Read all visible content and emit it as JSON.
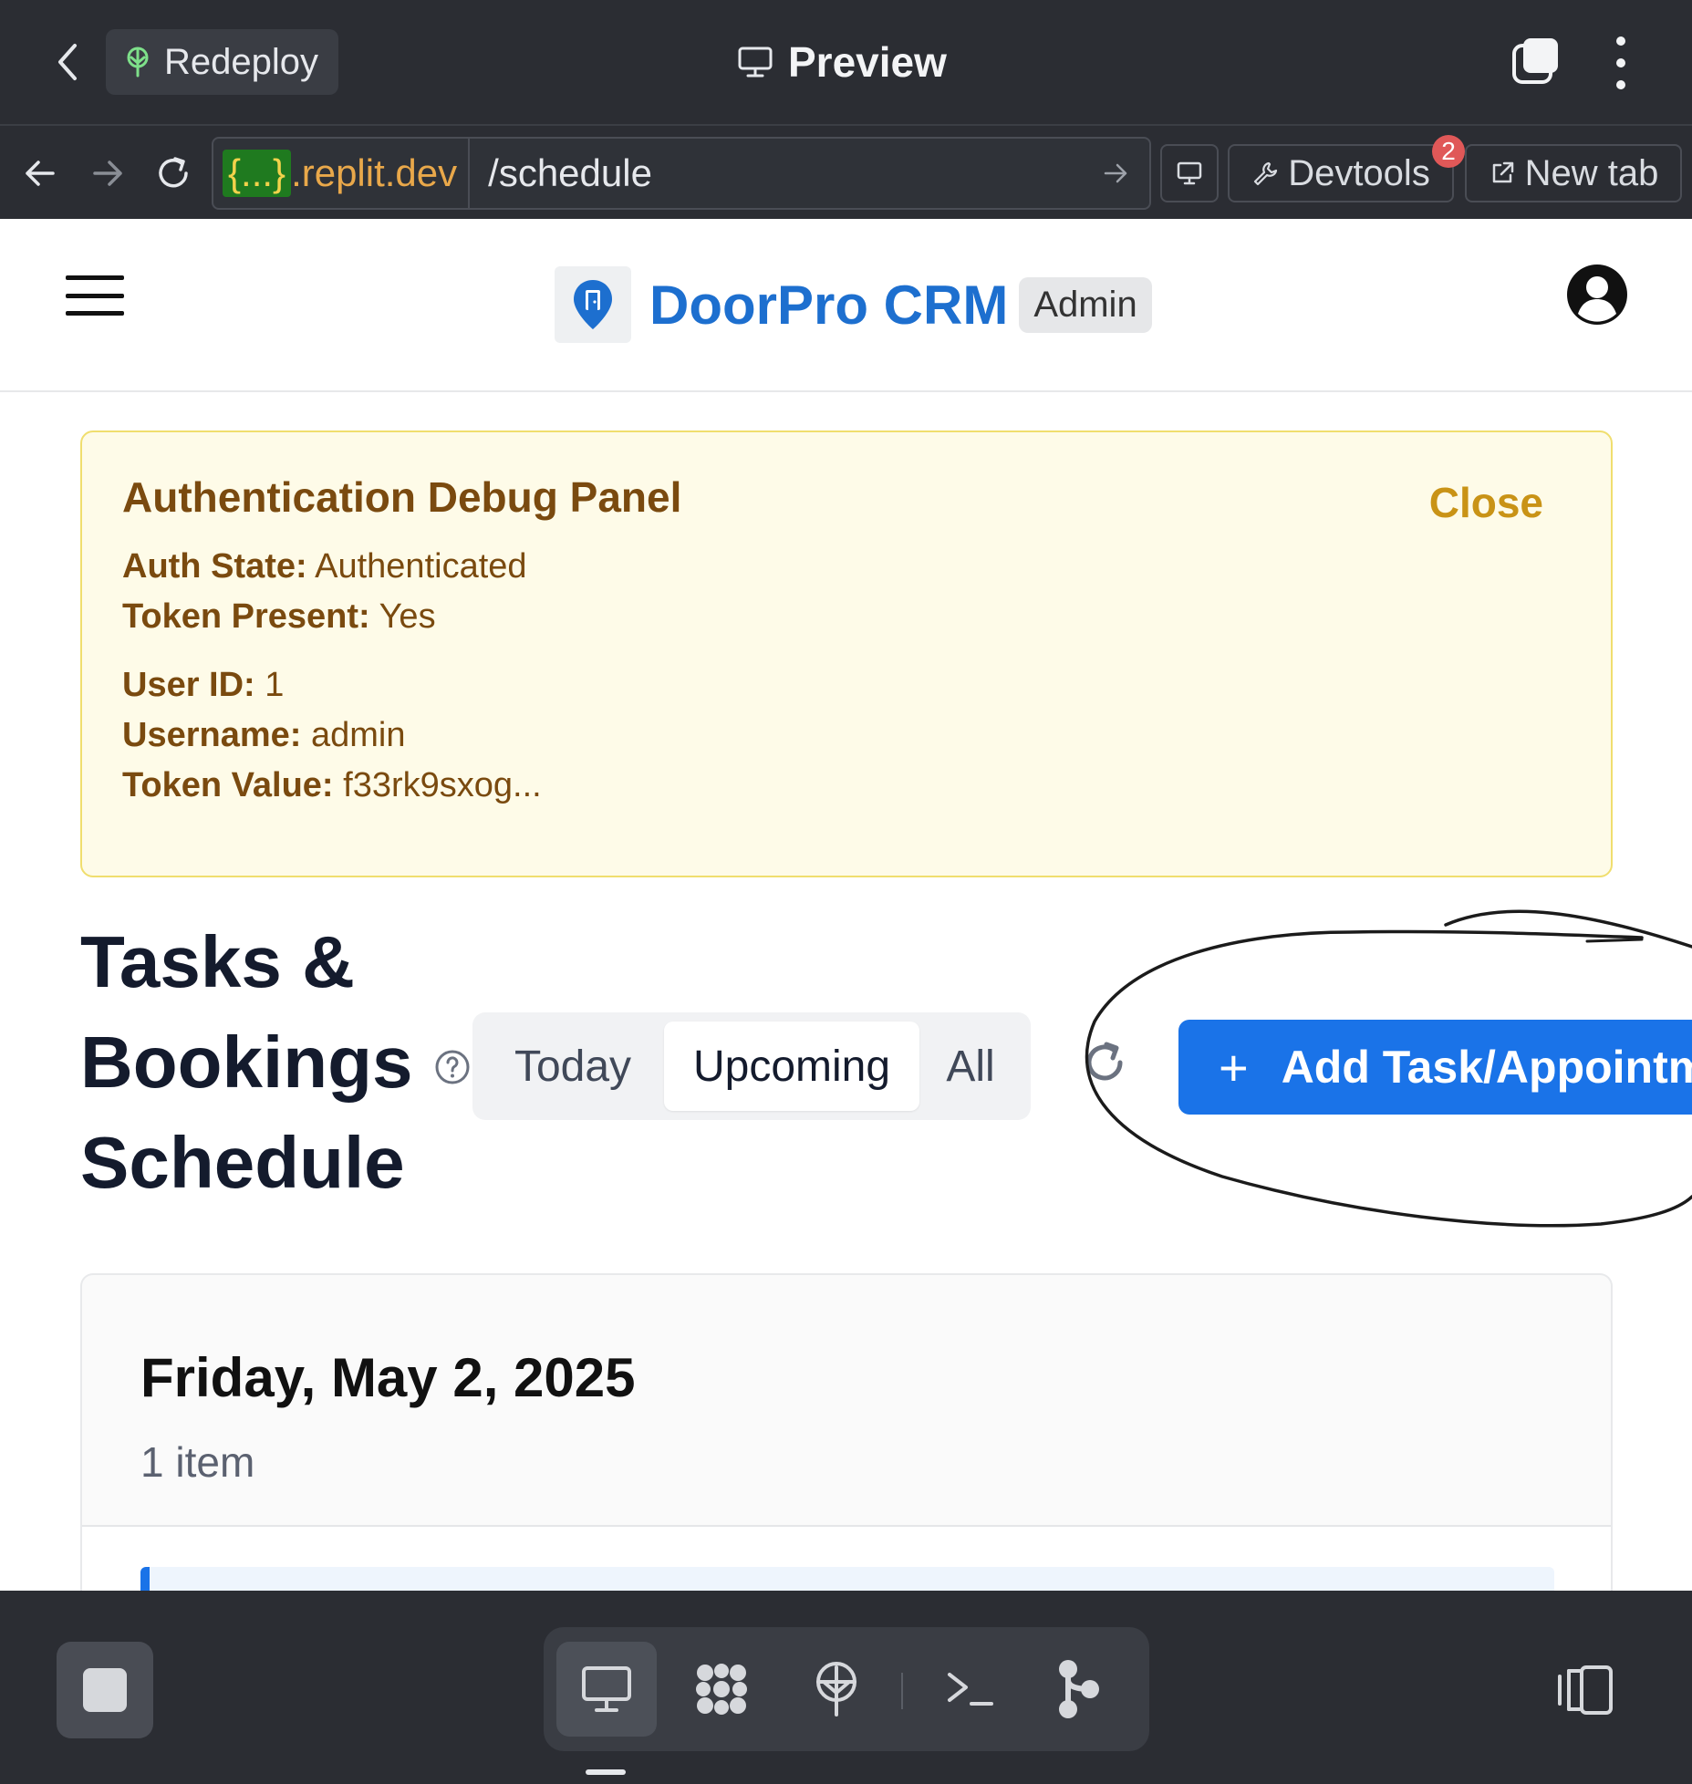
{
  "appbar": {
    "redeploy_label": "Redeploy",
    "title": "Preview"
  },
  "urlbar": {
    "host_badge": "{...}",
    "host_domain": ".replit.dev",
    "path": "/schedule",
    "devtools_label": "Devtools",
    "devtools_count": "2",
    "newtab_label": "New tab"
  },
  "header": {
    "brand": "DoorPro CRM",
    "role_badge": "Admin"
  },
  "debug_panel": {
    "title": "Authentication Debug Panel",
    "close_label": "Close",
    "auth_state_label": "Auth State:",
    "auth_state_value": "Authenticated",
    "token_present_label": "Token Present:",
    "token_present_value": "Yes",
    "user_id_label": "User ID:",
    "user_id_value": "1",
    "username_label": "Username:",
    "username_value": "admin",
    "token_value_label": "Token Value:",
    "token_value_value": "f33rk9sxog..."
  },
  "schedule": {
    "title": "Tasks & Bookings Schedule",
    "filters": [
      {
        "label": "Today",
        "active": false
      },
      {
        "label": "Upcoming",
        "active": true
      },
      {
        "label": "All",
        "active": false
      }
    ],
    "add_button_plus": "+",
    "add_button_label": "Add Task/Appointment"
  },
  "day_group": {
    "date": "Friday, May 2, 2025",
    "count": "1 item"
  },
  "colors": {
    "brand_blue": "#1d6fcf",
    "primary_button": "#1a73e8",
    "debug_bg": "#fefbe8",
    "debug_text": "#7a4a0f",
    "chrome_bg": "#2b2d33"
  }
}
